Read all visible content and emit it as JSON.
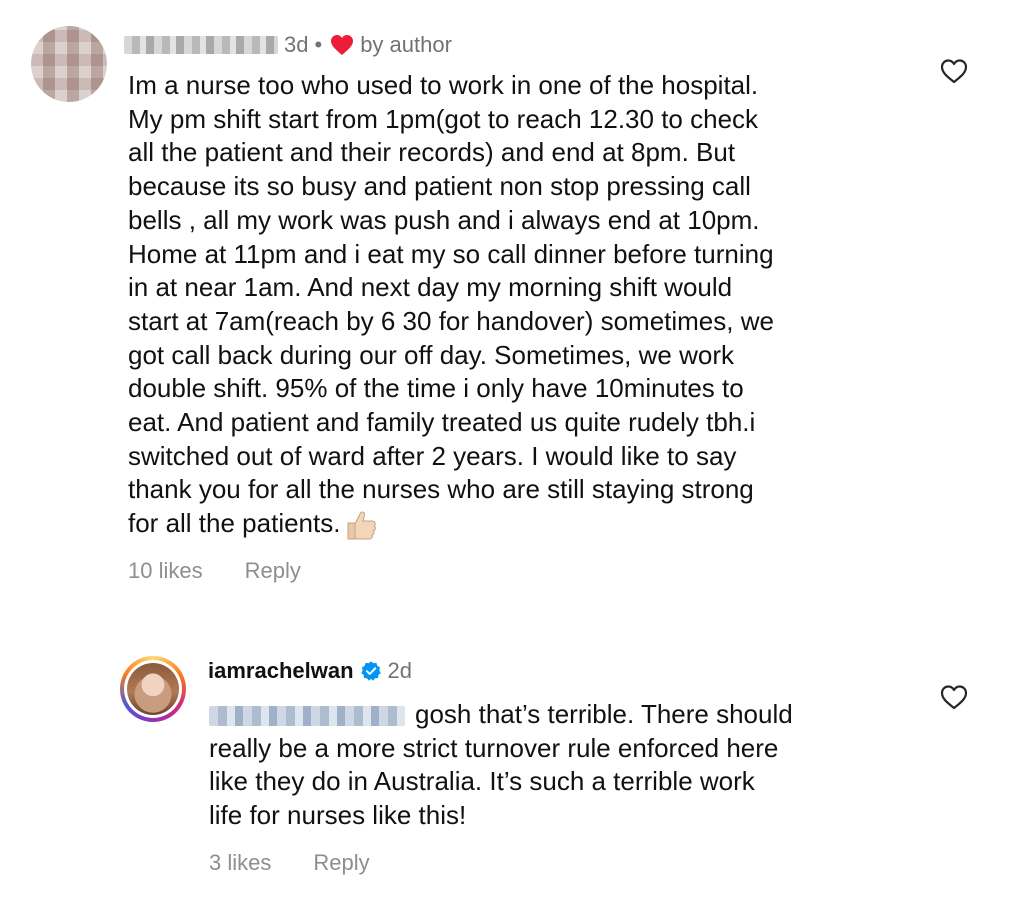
{
  "comment": {
    "time": "3d",
    "separator": "•",
    "by_author": "by author",
    "text": "Im a nurse too who used to work in one of the hospital.\nMy pm shift start from 1pm(got to reach 12.30 to check\nall the patient and their records) and end at 8pm. But\nbecause its so busy and patient non stop pressing call\nbells , all my work was push and i always end at 10pm.\nHome at 11pm and i eat my so call dinner before turning\nin at near 1am. And next day my morning shift would\nstart at 7am(reach by 6 30 for handover) sometimes, we\ngot call back during our off day. Sometimes, we work\ndouble shift. 95% of the time i only have 10minutes to\neat. And patient and family treated us quite rudely tbh.i\nswitched out of ward after 2 years.  I would like to say\nthank you for all the nurses who are still staying strong\nfor all the patients.",
    "likes": "10 likes",
    "reply_label": "Reply",
    "emoji": "thumbs-up"
  },
  "reply": {
    "username": "iamrachelwan",
    "time": "2d",
    "text": "gosh that’s terrible. There should\nreally be a more strict turnover rule enforced here\nlike they do in Australia. It’s such a terrible work\nlife for nurses like this!",
    "likes": "3 likes",
    "reply_label": "Reply"
  },
  "colors": {
    "heart": "#ed1c38",
    "muted": "#737373",
    "verified": "#0095f6"
  }
}
